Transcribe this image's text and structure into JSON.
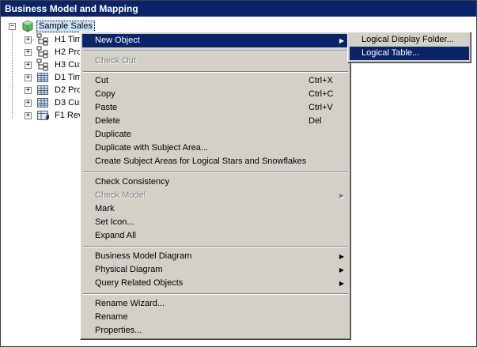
{
  "window": {
    "title": "Business Model and Mapping"
  },
  "tree": {
    "root": {
      "label": "Sample Sales",
      "expander": "−"
    },
    "children": [
      {
        "label": "H1 Tim",
        "expander": "+",
        "icon": "hierarchy-icon"
      },
      {
        "label": "H2 Pro",
        "expander": "+",
        "icon": "hierarchy-icon"
      },
      {
        "label": "H3 Cus",
        "expander": "+",
        "icon": "hierarchy-icon"
      },
      {
        "label": "D1 Tim",
        "expander": "+",
        "icon": "dimension-table-icon"
      },
      {
        "label": "D2 Pro",
        "expander": "+",
        "icon": "dimension-table-icon"
      },
      {
        "label": "D3 Cus",
        "expander": "+",
        "icon": "dimension-table-icon"
      },
      {
        "label": "F1 Rev",
        "expander": "+",
        "icon": "fact-table-icon"
      }
    ]
  },
  "context_menu": {
    "new_object": "New Object",
    "check_out": "Check Out",
    "cut": "Cut",
    "cut_shortcut": "Ctrl+X",
    "copy": "Copy",
    "copy_shortcut": "Ctrl+C",
    "paste": "Paste",
    "paste_shortcut": "Ctrl+V",
    "delete": "Delete",
    "delete_shortcut": "Del",
    "duplicate": "Duplicate",
    "duplicate_with_subject_area": "Duplicate with Subject Area...",
    "create_subject_areas": "Create Subject Areas for Logical Stars and Snowflakes",
    "check_consistency": "Check Consistency",
    "check_model": "Check Model",
    "mark": "Mark",
    "set_icon": "Set Icon...",
    "expand_all": "Expand All",
    "business_model_diagram": "Business Model Diagram",
    "physical_diagram": "Physical Diagram",
    "query_related_objects": "Query Related Objects",
    "rename_wizard": "Rename Wizard...",
    "rename": "Rename",
    "properties": "Properties...",
    "submenu_arrow": "▶"
  },
  "submenu": {
    "logical_display_folder": "Logical Display Folder...",
    "logical_table": "Logical Table..."
  },
  "colors": {
    "title_bar": "#0a246a",
    "menu_highlight": "#0a246a",
    "menu_background": "#d4d0c8",
    "root_selection": "#cce4f7"
  }
}
